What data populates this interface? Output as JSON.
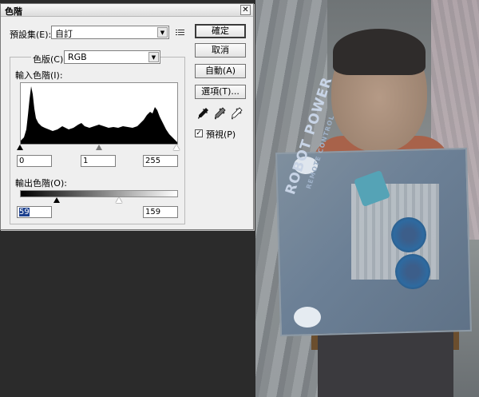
{
  "dialog": {
    "title": "色階",
    "close_label": "✕",
    "preset_label": "預設集(E):",
    "preset_value": "自訂",
    "channel_label": "色版(C):",
    "channel_value": "RGB",
    "input_levels_label": "輸入色階(I):",
    "input_values": [
      "0",
      "1",
      "255"
    ],
    "output_levels_label": "輸出色階(O):",
    "output_values": [
      "59",
      "159"
    ],
    "buttons": {
      "ok": "確定",
      "cancel": "取消",
      "auto": "自動(A)",
      "options": "選項(T)..."
    },
    "preview_label": "預視(P)",
    "preview_checked": true
  },
  "photo": {
    "box_title": "ROBOT POWER",
    "box_subtitle": "REMOTE CONTROL"
  },
  "colors": {
    "dialog_bg": "#efefef",
    "workspace_bg": "#2b2b2b",
    "selection": "#1b3f8e"
  }
}
